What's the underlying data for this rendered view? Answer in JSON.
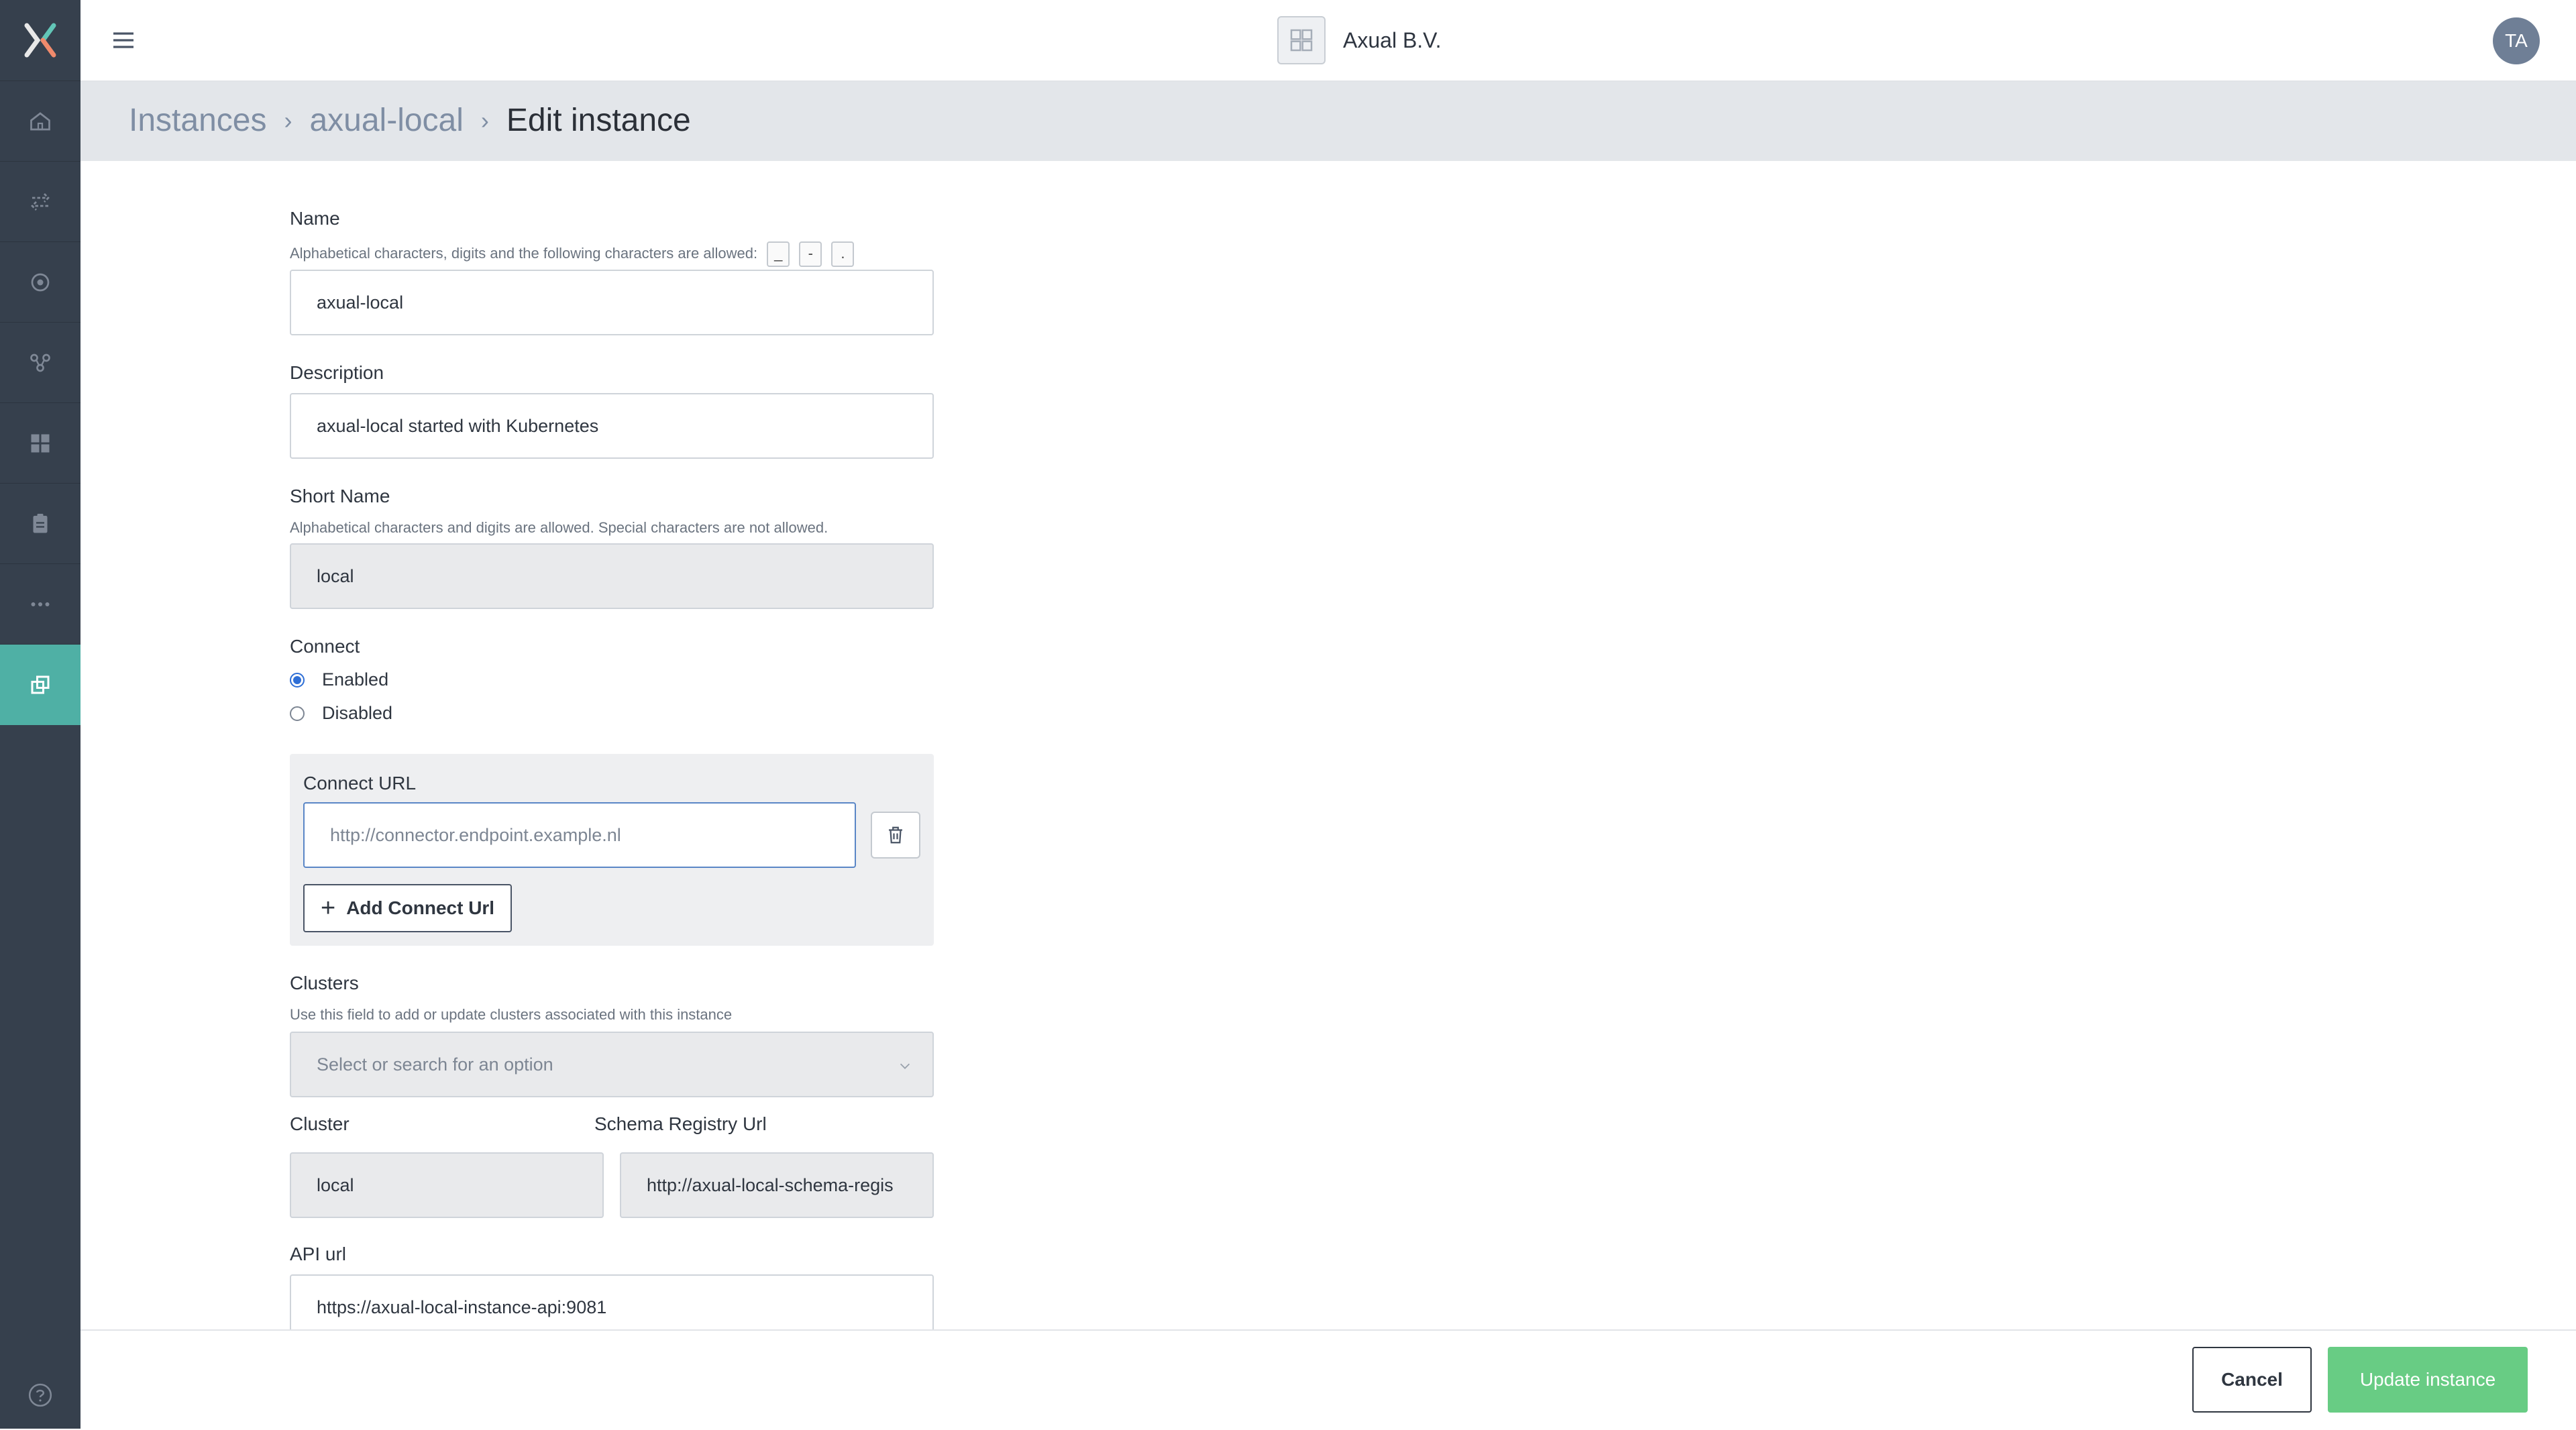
{
  "topbar": {
    "org_name": "Axual B.V.",
    "avatar_initials": "TA"
  },
  "breadcrumb": {
    "items": [
      "Instances",
      "axual-local",
      "Edit instance"
    ]
  },
  "form": {
    "name": {
      "label": "Name",
      "hint": "Alphabetical characters, digits and the following characters are allowed:",
      "allowed_chars": [
        "_",
        "-",
        "."
      ],
      "value": "axual-local"
    },
    "description": {
      "label": "Description",
      "value": "axual-local started with Kubernetes"
    },
    "short_name": {
      "label": "Short Name",
      "hint": "Alphabetical characters and digits are allowed. Special characters are not allowed.",
      "value": "local"
    },
    "connect": {
      "label": "Connect",
      "options": [
        "Enabled",
        "Disabled"
      ],
      "selected": "Enabled"
    },
    "connect_url": {
      "label": "Connect URL",
      "placeholder": "http://connector.endpoint.example.nl",
      "add_button": "Add Connect Url"
    },
    "clusters": {
      "label": "Clusters",
      "hint": "Use this field to add or update clusters associated with this instance",
      "placeholder": "Select or search for an option",
      "cluster_label": "Cluster",
      "cluster_value": "local",
      "schema_registry_label": "Schema Registry Url",
      "schema_registry_value": "http://axual-local-schema-regis"
    },
    "api_url": {
      "label": "API url",
      "value": "https://axual-local-instance-api:9081"
    }
  },
  "footer": {
    "cancel_label": "Cancel",
    "update_label": "Update instance"
  },
  "colors": {
    "sidebar": "#36404d",
    "active": "#4fb0a5",
    "primary": "#68cc84"
  }
}
